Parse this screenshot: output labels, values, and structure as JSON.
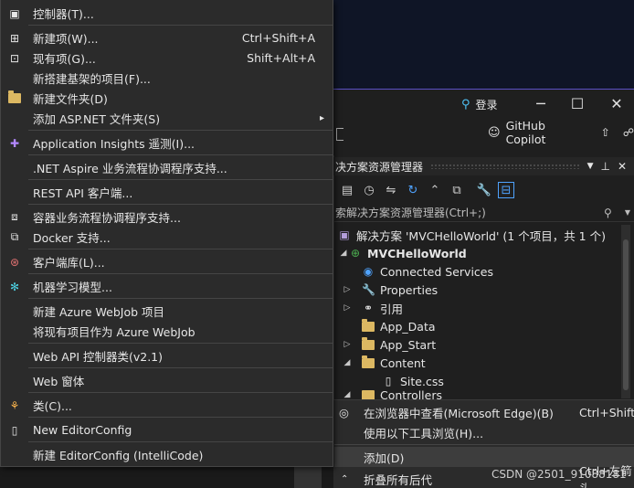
{
  "titlebar": {
    "login_label": "登录",
    "minimize_glyph": "─",
    "maximize_glyph": "☐",
    "close_glyph": "✕"
  },
  "copilot": {
    "label": "GitHub Copilot"
  },
  "solution_explorer": {
    "title": "决方案资源管理器",
    "search_placeholder": "索解决方案资源管理器(Ctrl+;)",
    "solution_label": "解决方案 'MVCHelloWorld' (1 个项目，共 1 个)",
    "project_label": "MVCHelloWorld",
    "nodes": {
      "connected_services": "Connected Services",
      "properties": "Properties",
      "references": "引用",
      "app_data": "App_Data",
      "app_start": "App_Start",
      "content": "Content",
      "site_css": "Site.css",
      "controllers_partial": "Controllers"
    }
  },
  "sub_menu": {
    "view_in_browser": "在浏览器中查看(Microsoft Edge)(B)",
    "view_in_browser_shortcut": "Ctrl+Shift+",
    "browse_with": "使用以下工具浏览(H)...",
    "add": "添加(D)",
    "collapse_all": "折叠所有后代",
    "collapse_shortcut": "Ctrl+左箭头"
  },
  "menu": {
    "items": [
      {
        "label": "控制器(T)...",
        "shortcut": "",
        "icon": "controller-icon"
      },
      {
        "label": "新建项(W)...",
        "shortcut": "Ctrl+Shift+A",
        "icon": "new-item-icon"
      },
      {
        "label": "现有项(G)...",
        "shortcut": "Shift+Alt+A",
        "icon": "existing-item-icon"
      },
      {
        "label": "新搭建基架的项目(F)...",
        "shortcut": "",
        "icon": ""
      },
      {
        "label": "新建文件夹(D)",
        "shortcut": "",
        "icon": "new-folder-icon"
      },
      {
        "label": "添加 ASP.NET 文件夹(S)",
        "shortcut": "",
        "icon": ""
      },
      {
        "label": "Application Insights 遥测(I)...",
        "shortcut": "",
        "icon": "app-insights-icon"
      },
      {
        "label": ".NET Aspire 业务流程协调程序支持...",
        "shortcut": "",
        "icon": ""
      },
      {
        "label": "REST API 客户端...",
        "shortcut": "",
        "icon": ""
      },
      {
        "label": "容器业务流程协调程序支持...",
        "shortcut": "",
        "icon": "container-icon"
      },
      {
        "label": "Docker 支持...",
        "shortcut": "",
        "icon": "docker-icon"
      },
      {
        "label": "客户端库(L)...",
        "shortcut": "",
        "icon": "client-library-icon"
      },
      {
        "label": "机器学习模型...",
        "shortcut": "",
        "icon": "ml-model-icon"
      },
      {
        "label": "新建 Azure WebJob 项目",
        "shortcut": "",
        "icon": ""
      },
      {
        "label": "将现有项目作为 Azure WebJob",
        "shortcut": "",
        "icon": ""
      },
      {
        "label": "Web API 控制器类(v2.1)",
        "shortcut": "",
        "icon": ""
      },
      {
        "label": "Web 窗体",
        "shortcut": "",
        "icon": ""
      },
      {
        "label": "类(C)...",
        "shortcut": "",
        "icon": "class-icon"
      },
      {
        "label": "New EditorConfig",
        "shortcut": "",
        "icon": "editorconfig-icon"
      },
      {
        "label": "新建 EditorConfig (IntelliCode)",
        "shortcut": "",
        "icon": ""
      }
    ],
    "submenu_arrow": "▸"
  },
  "watermark": "CSDN @2501_91088181"
}
